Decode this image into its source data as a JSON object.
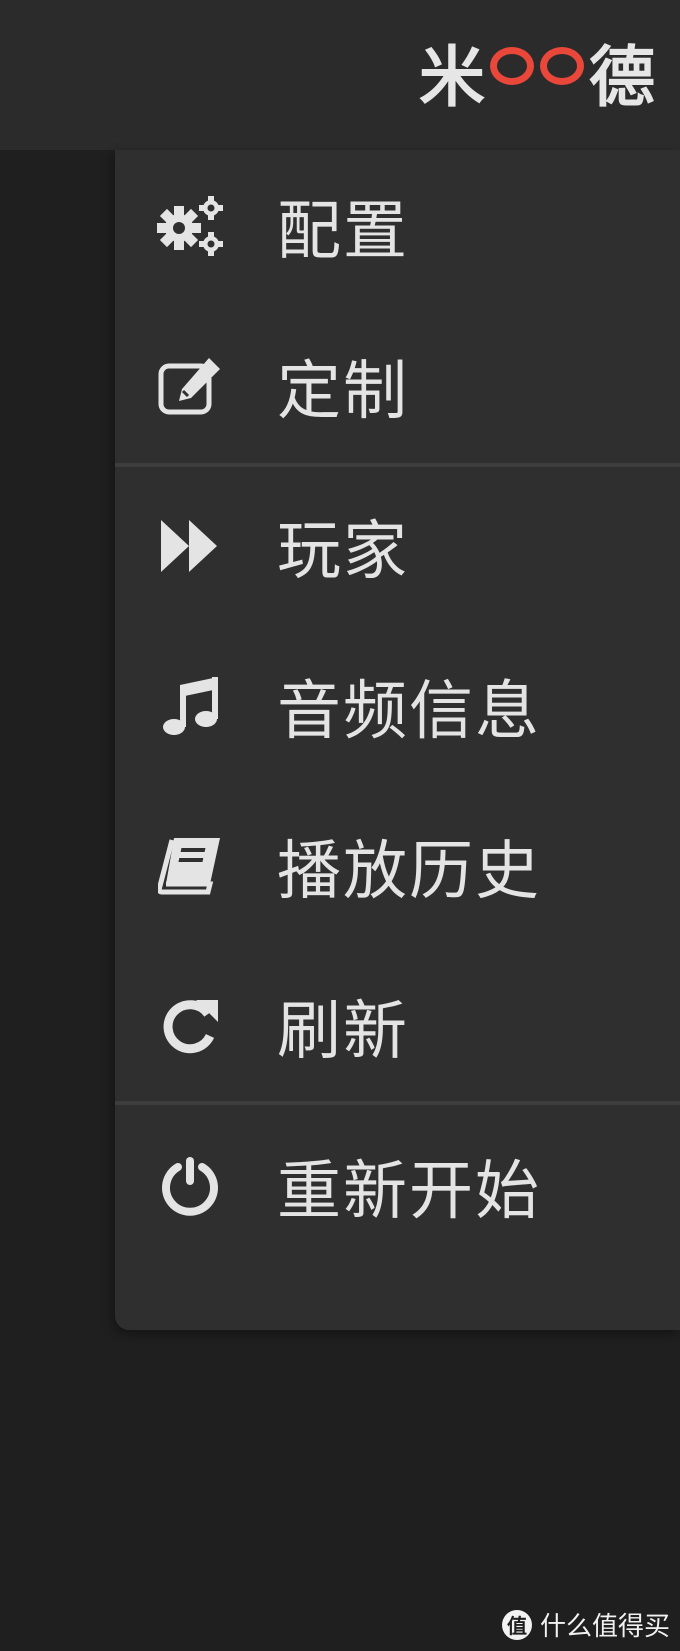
{
  "header": {
    "logo": {
      "left": "米",
      "middle": "OO",
      "right": "德"
    }
  },
  "menu": {
    "items": [
      {
        "id": "config",
        "label": "配置",
        "icon": "gears-icon"
      },
      {
        "id": "customize",
        "label": "定制",
        "icon": "edit-icon"
      },
      {
        "id": "player",
        "label": "玩家",
        "icon": "fast-forward-icon"
      },
      {
        "id": "audio-info",
        "label": "音频信息",
        "icon": "music-note-icon"
      },
      {
        "id": "history",
        "label": "播放历史",
        "icon": "book-icon"
      },
      {
        "id": "refresh",
        "label": "刷新",
        "icon": "refresh-icon"
      },
      {
        "id": "restart",
        "label": "重新开始",
        "icon": "power-icon"
      }
    ]
  },
  "watermark": {
    "logo": "值",
    "text": "什么值得买"
  },
  "colors": {
    "background": "#1f1f1f",
    "topbar": "#2b2b2b",
    "menu": "#2f2f2f",
    "text": "#e4e4e4",
    "logo_accent": "#e8473a"
  }
}
